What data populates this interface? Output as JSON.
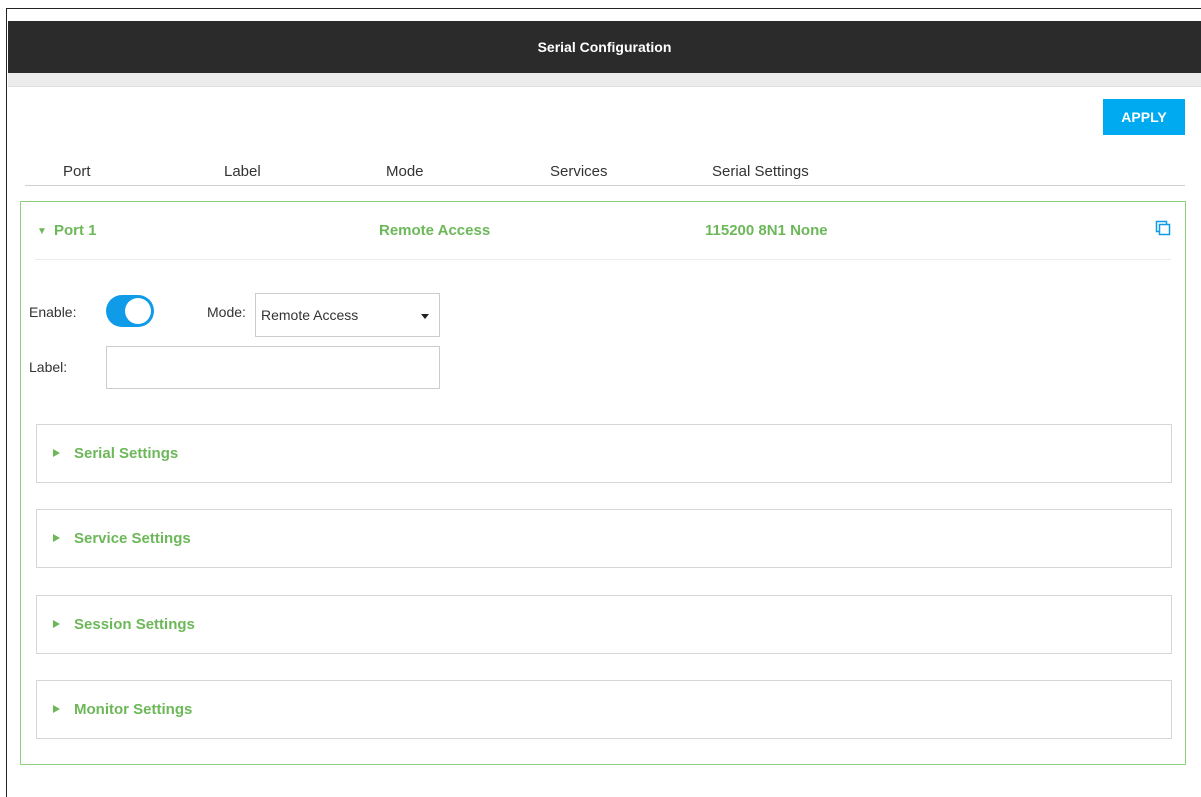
{
  "window": {
    "title": "Serial Configuration"
  },
  "toolbar": {
    "apply_label": "APPLY"
  },
  "columns": [
    "Port",
    "Label",
    "Mode",
    "Services",
    "Serial Settings"
  ],
  "port": {
    "name": "Port 1",
    "mode": "Remote Access",
    "serial_summary": "115200 8N1 None",
    "enable_label": "Enable:",
    "enabled": true,
    "mode_label": "Mode:",
    "mode_selected": "Remote Access",
    "label_label": "Label:",
    "label_value": ""
  },
  "sections": [
    {
      "title": "Serial Settings"
    },
    {
      "title": "Service Settings"
    },
    {
      "title": "Session Settings"
    },
    {
      "title": "Monitor Settings"
    }
  ],
  "icons": {
    "expand": "caret-down-icon",
    "copy": "copy-icon",
    "section_toggle": "caret-right-icon"
  },
  "colors": {
    "titlebar": "#2b2b2b",
    "accent": "#00aaf0",
    "toggle_on": "#0f9be8",
    "green_text": "#6cb859",
    "panel_border": "#8fcf7f"
  }
}
